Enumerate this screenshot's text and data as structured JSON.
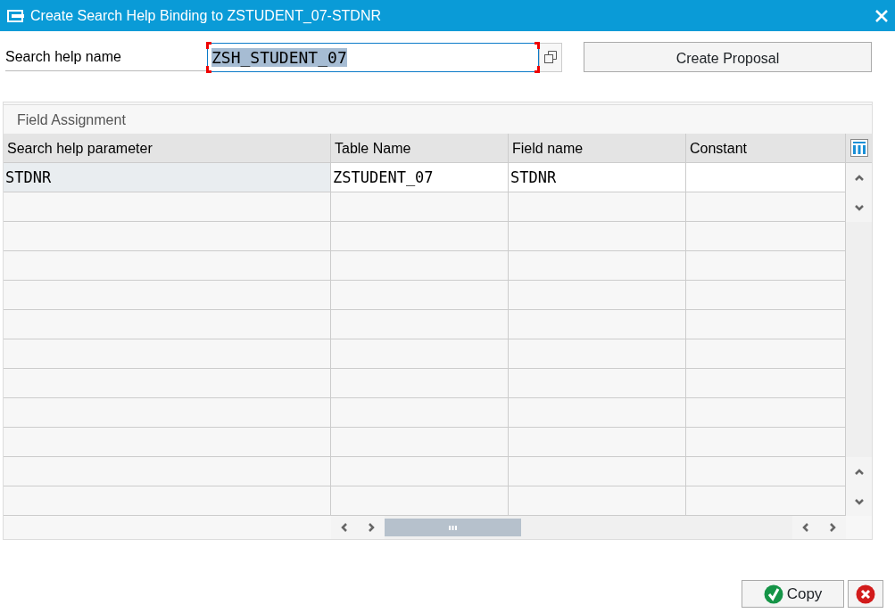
{
  "window": {
    "title": "Create Search Help Binding to ZSTUDENT_07-STDNR"
  },
  "search_help": {
    "label": "Search help name",
    "value": "ZSH_STUDENT_07",
    "focused": true
  },
  "proposal_button": "Create Proposal",
  "field_assignment": {
    "title": "Field Assignment",
    "columns": [
      "Search help parameter",
      "Table Name",
      "Field name",
      "Constant"
    ],
    "rows": [
      {
        "cells": [
          "STDNR",
          "ZSTUDENT_07",
          "STDNR",
          ""
        ]
      }
    ]
  },
  "buttons": {
    "copy": "Copy"
  }
}
